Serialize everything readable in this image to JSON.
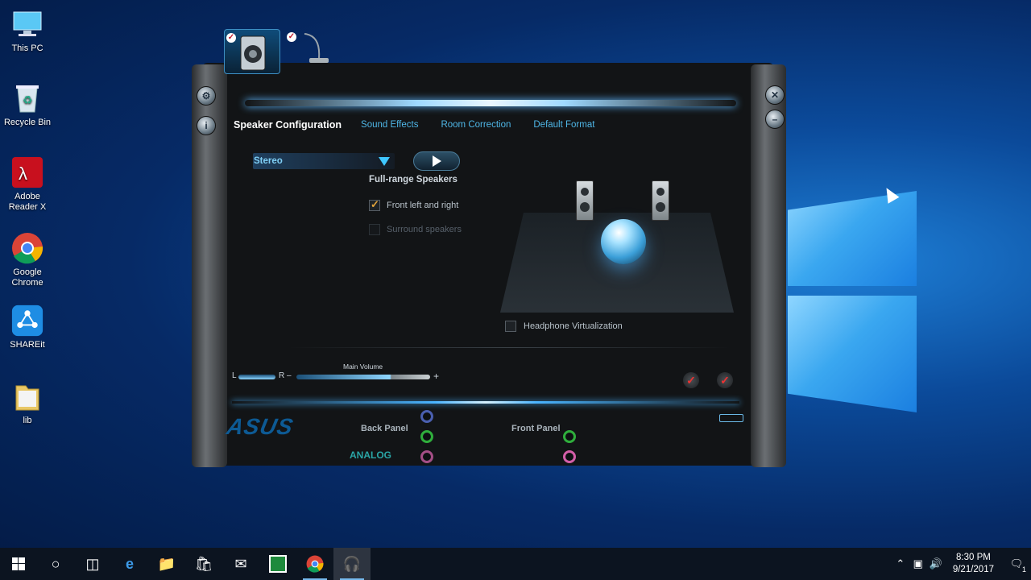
{
  "desktop": {
    "icons": [
      {
        "label": "This PC",
        "icon": "this-pc-icon"
      },
      {
        "label": "Recycle Bin",
        "icon": "recycle-bin-icon"
      },
      {
        "label": "Adobe Reader X",
        "icon": "adobe-reader-icon"
      },
      {
        "label": "Google Chrome",
        "icon": "chrome-icon"
      },
      {
        "label": "SHAREit",
        "icon": "shareit-icon"
      },
      {
        "label": "lib",
        "icon": "folder-icon"
      }
    ]
  },
  "app": {
    "tabs": [
      {
        "label": "Speaker Configuration",
        "active": true
      },
      {
        "label": "Sound Effects",
        "active": false
      },
      {
        "label": "Room Correction",
        "active": false
      },
      {
        "label": "Default Format",
        "active": false
      }
    ],
    "config_select": "Stereo",
    "section_title": "Full-range Speakers",
    "front_left_right": {
      "label": "Front left and right",
      "checked": true
    },
    "surround": {
      "label": "Surround speakers",
      "checked": false
    },
    "headphone_virtualization": {
      "label": "Headphone Virtualization",
      "checked": false
    },
    "volume": {
      "title": "Main Volume",
      "balance_left": "L",
      "balance_right": "R",
      "minus": "–",
      "plus": "+",
      "level": 0.72,
      "balance": 0.5
    },
    "brand": "ASUS",
    "back_panel": "Back Panel",
    "front_panel": "Front Panel",
    "analog": "ANALOG",
    "jack_colors": {
      "blue": "#4a5fb0",
      "green": "#2fae3c",
      "pink": "#d35ea8"
    }
  },
  "taskbar": {
    "time": "8:30 PM",
    "date": "9/21/2017",
    "notifications": "1"
  },
  "colors": {
    "accent": "#4fb7e8",
    "taskbar": "#0c1420"
  }
}
